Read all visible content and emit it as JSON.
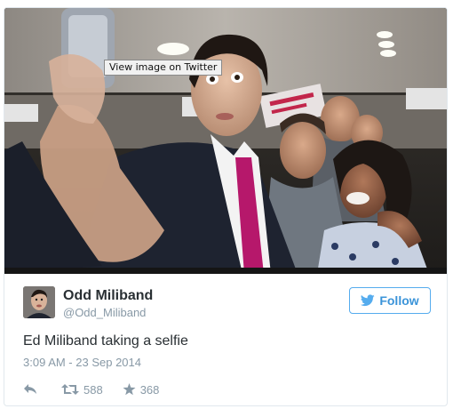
{
  "media": {
    "tooltip": "View image on Twitter",
    "alt": "Ed Miliband taking a selfie"
  },
  "author": {
    "name": "Odd Miliband",
    "handle": "@Odd_Miliband",
    "avatar_icon": "avatar-photo"
  },
  "follow": {
    "label": "Follow",
    "icon": "twitter-bird-icon",
    "color": "#3b94d9",
    "border_color": "#55acee"
  },
  "tweet": {
    "text": "Ed Miliband taking a selfie",
    "timestamp": "3:09 AM - 23 Sep 2014"
  },
  "actions": {
    "reply_icon": "reply-icon",
    "retweet_icon": "retweet-icon",
    "retweet_count": "588",
    "favorite_icon": "star-icon",
    "favorite_count": "368"
  },
  "colors": {
    "text_primary": "#292f33",
    "text_secondary": "#8899a6",
    "border": "#e1e8ed"
  }
}
